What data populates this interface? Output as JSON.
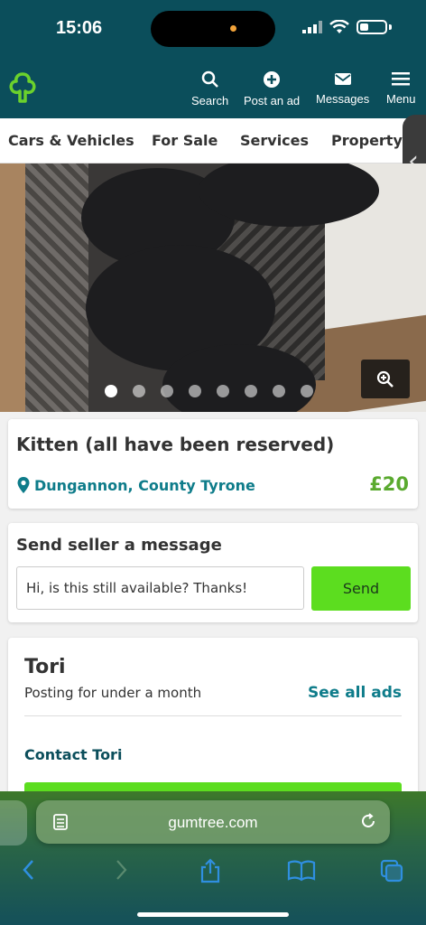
{
  "status": {
    "time": "15:06"
  },
  "header": {
    "nav": [
      {
        "label": "Search",
        "icon": "search-icon"
      },
      {
        "label": "Post an ad",
        "icon": "plus-circle-icon"
      },
      {
        "label": "Messages",
        "icon": "envelope-icon"
      },
      {
        "label": "Menu",
        "icon": "hamburger-icon"
      }
    ]
  },
  "categories": [
    "Cars & Vehicles",
    "For Sale",
    "Services",
    "Property"
  ],
  "gallery": {
    "image_count": 8,
    "active_index": 0
  },
  "listing": {
    "title": "Kitten (all have been reserved)",
    "location": "Dungannon, County Tyrone",
    "price": "£20"
  },
  "message": {
    "heading": "Send seller a message",
    "input_value": "Hi, is this still available? Thanks!",
    "send_label": "Send"
  },
  "seller": {
    "name": "Tori",
    "posting_duration": "Posting for under a month",
    "see_all_label": "See all ads",
    "contact_label": "Contact Tori"
  },
  "browser": {
    "url": "gumtree.com"
  },
  "colors": {
    "header_bg": "#0b4e5b",
    "accent_green": "#5cdd1f",
    "price_green": "#5aaa2f",
    "link_teal": "#0e7c8a"
  }
}
